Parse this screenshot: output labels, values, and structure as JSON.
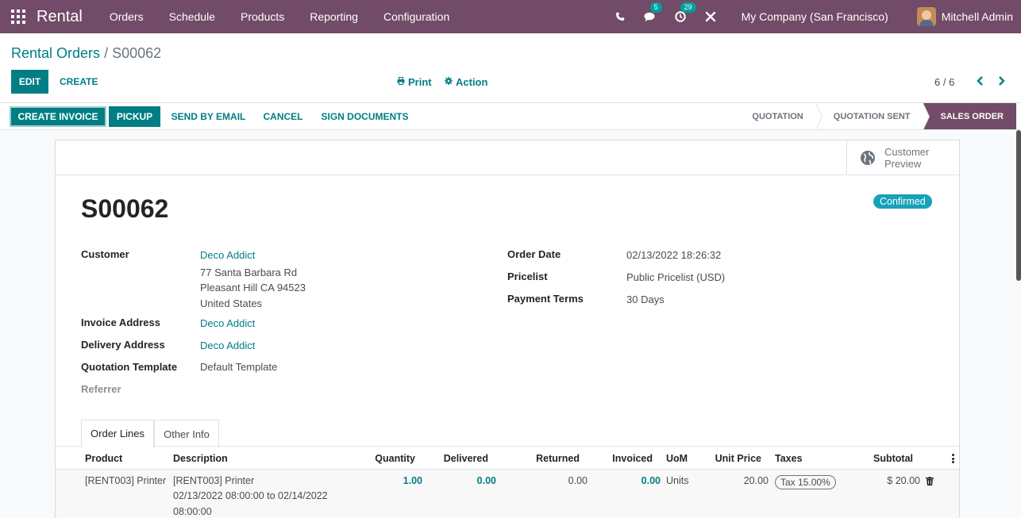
{
  "navbar": {
    "app_name": "Rental",
    "menu": [
      "Orders",
      "Schedule",
      "Products",
      "Reporting",
      "Configuration"
    ],
    "messages_count": "5",
    "activities_count": "29",
    "company": "My Company (San Francisco)",
    "user": "Mitchell Admin"
  },
  "breadcrumb": {
    "parent": "Rental Orders",
    "separator": "/",
    "current": "S00062"
  },
  "control": {
    "edit_label": "EDIT",
    "create_label": "CREATE",
    "print_label": "Print",
    "action_label": "Action",
    "pager": "6 / 6"
  },
  "statusbar": {
    "buttons": [
      "CREATE INVOICE",
      "PICKUP",
      "SEND BY EMAIL",
      "CANCEL",
      "SIGN DOCUMENTS"
    ],
    "stages": [
      "QUOTATION",
      "QUOTATION SENT",
      "SALES ORDER"
    ]
  },
  "smart_button": {
    "line1": "Customer",
    "line2": "Preview"
  },
  "form": {
    "name": "S00062",
    "status": "Confirmed",
    "customer_label": "Customer",
    "customer": "Deco Addict",
    "address_1": "77 Santa Barbara Rd",
    "address_2": "Pleasant Hill CA 94523",
    "address_3": "United States",
    "invoice_address_label": "Invoice Address",
    "invoice_address": "Deco Addict",
    "delivery_address_label": "Delivery Address",
    "delivery_address": "Deco Addict",
    "template_label": "Quotation Template",
    "template": "Default Template",
    "referrer_label": "Referrer",
    "order_date_label": "Order Date",
    "order_date": "02/13/2022 18:26:32",
    "pricelist_label": "Pricelist",
    "pricelist": "Public Pricelist (USD)",
    "payment_terms_label": "Payment Terms",
    "payment_terms": "30 Days"
  },
  "tabs": [
    "Order Lines",
    "Other Info"
  ],
  "table": {
    "columns": [
      "Product",
      "Description",
      "Quantity",
      "Delivered",
      "Returned",
      "Invoiced",
      "UoM",
      "Unit Price",
      "Taxes",
      "Subtotal"
    ],
    "rows": [
      {
        "product": "[RENT003] Printer",
        "description_1": "[RENT003] Printer",
        "description_2": "02/13/2022 08:00:00 to 02/14/2022",
        "description_3": "08:00:00",
        "quantity": "1.00",
        "delivered": "0.00",
        "returned": "0.00",
        "invoiced": "0.00",
        "uom": "Units",
        "unit_price": "20.00",
        "taxes": "Tax 15.00%",
        "subtotal": "$ 20.00"
      }
    ]
  },
  "colors": {
    "brand": "#714b67",
    "accent": "#017e84",
    "badge": "#17a2b8"
  },
  "icons": [
    "apps-grid-icon",
    "phone-icon",
    "chat-icon",
    "clock-icon",
    "tools-icon",
    "print-icon",
    "gear-icon",
    "chevron-left-icon",
    "chevron-right-icon",
    "globe-icon",
    "trash-icon",
    "kebab-icon"
  ]
}
